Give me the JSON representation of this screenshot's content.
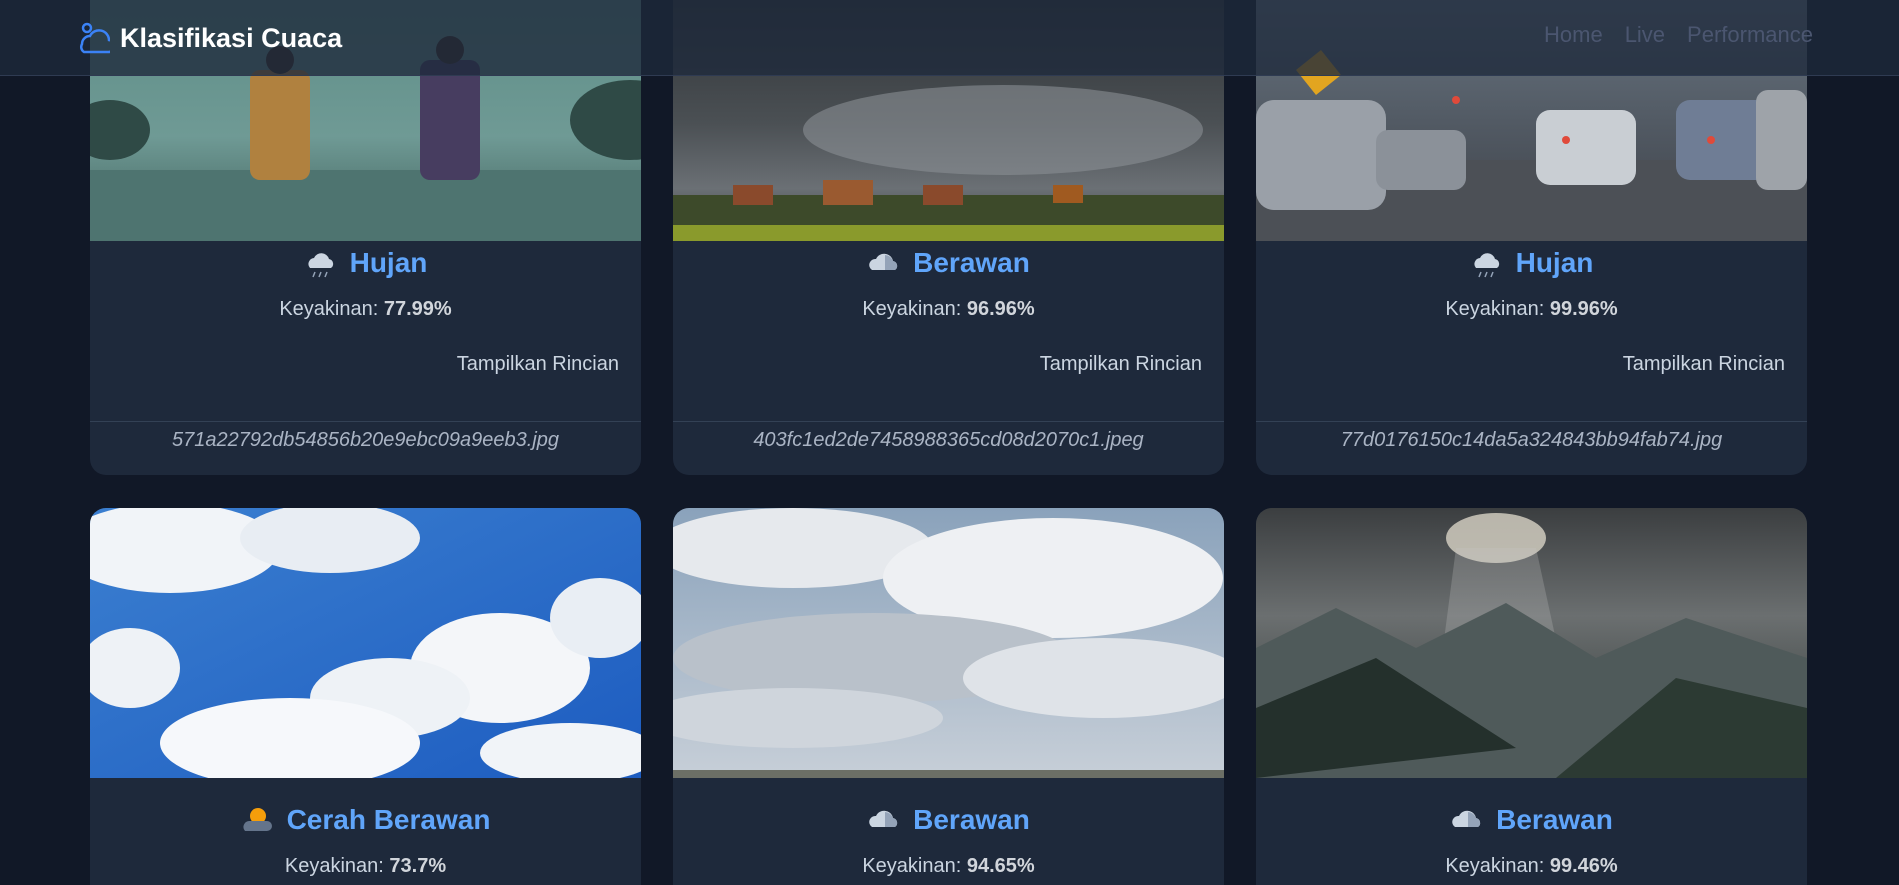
{
  "app": {
    "title": "Klasifikasi Cuaca"
  },
  "nav": {
    "items": [
      "Home",
      "Live",
      "Performance"
    ]
  },
  "cards": [
    {
      "label": "Hujan",
      "confidence_label": "Keyakinan:",
      "confidence": "77.99%",
      "details_label": "Tampilkan Rincian",
      "filename": "571a22792db54856b20e9ebc09a9eeb3.jpg",
      "icon": "rain-cloud-icon"
    },
    {
      "label": "Berawan",
      "confidence_label": "Keyakinan:",
      "confidence": "96.96%",
      "details_label": "Tampilkan Rincian",
      "filename": "403fc1ed2de7458988365cd08d2070c1.jpeg",
      "icon": "cloud-icon"
    },
    {
      "label": "Hujan",
      "confidence_label": "Keyakinan:",
      "confidence": "99.96%",
      "details_label": "Tampilkan Rincian",
      "filename": "77d0176150c14da5a324843bb94fab74.jpg",
      "icon": "rain-cloud-icon"
    },
    {
      "label": "Cerah Berawan",
      "confidence_label": "Keyakinan:",
      "confidence": "73.7%",
      "icon": "sun-behind-cloud-icon"
    },
    {
      "label": "Berawan",
      "confidence_label": "Keyakinan:",
      "confidence": "94.65%",
      "icon": "cloud-icon"
    },
    {
      "label": "Berawan",
      "confidence_label": "Keyakinan:",
      "confidence": "99.46%",
      "icon": "cloud-icon"
    }
  ],
  "colors": {
    "accent": "#60a5fa",
    "card": "#1e293b",
    "background": "#111827"
  }
}
